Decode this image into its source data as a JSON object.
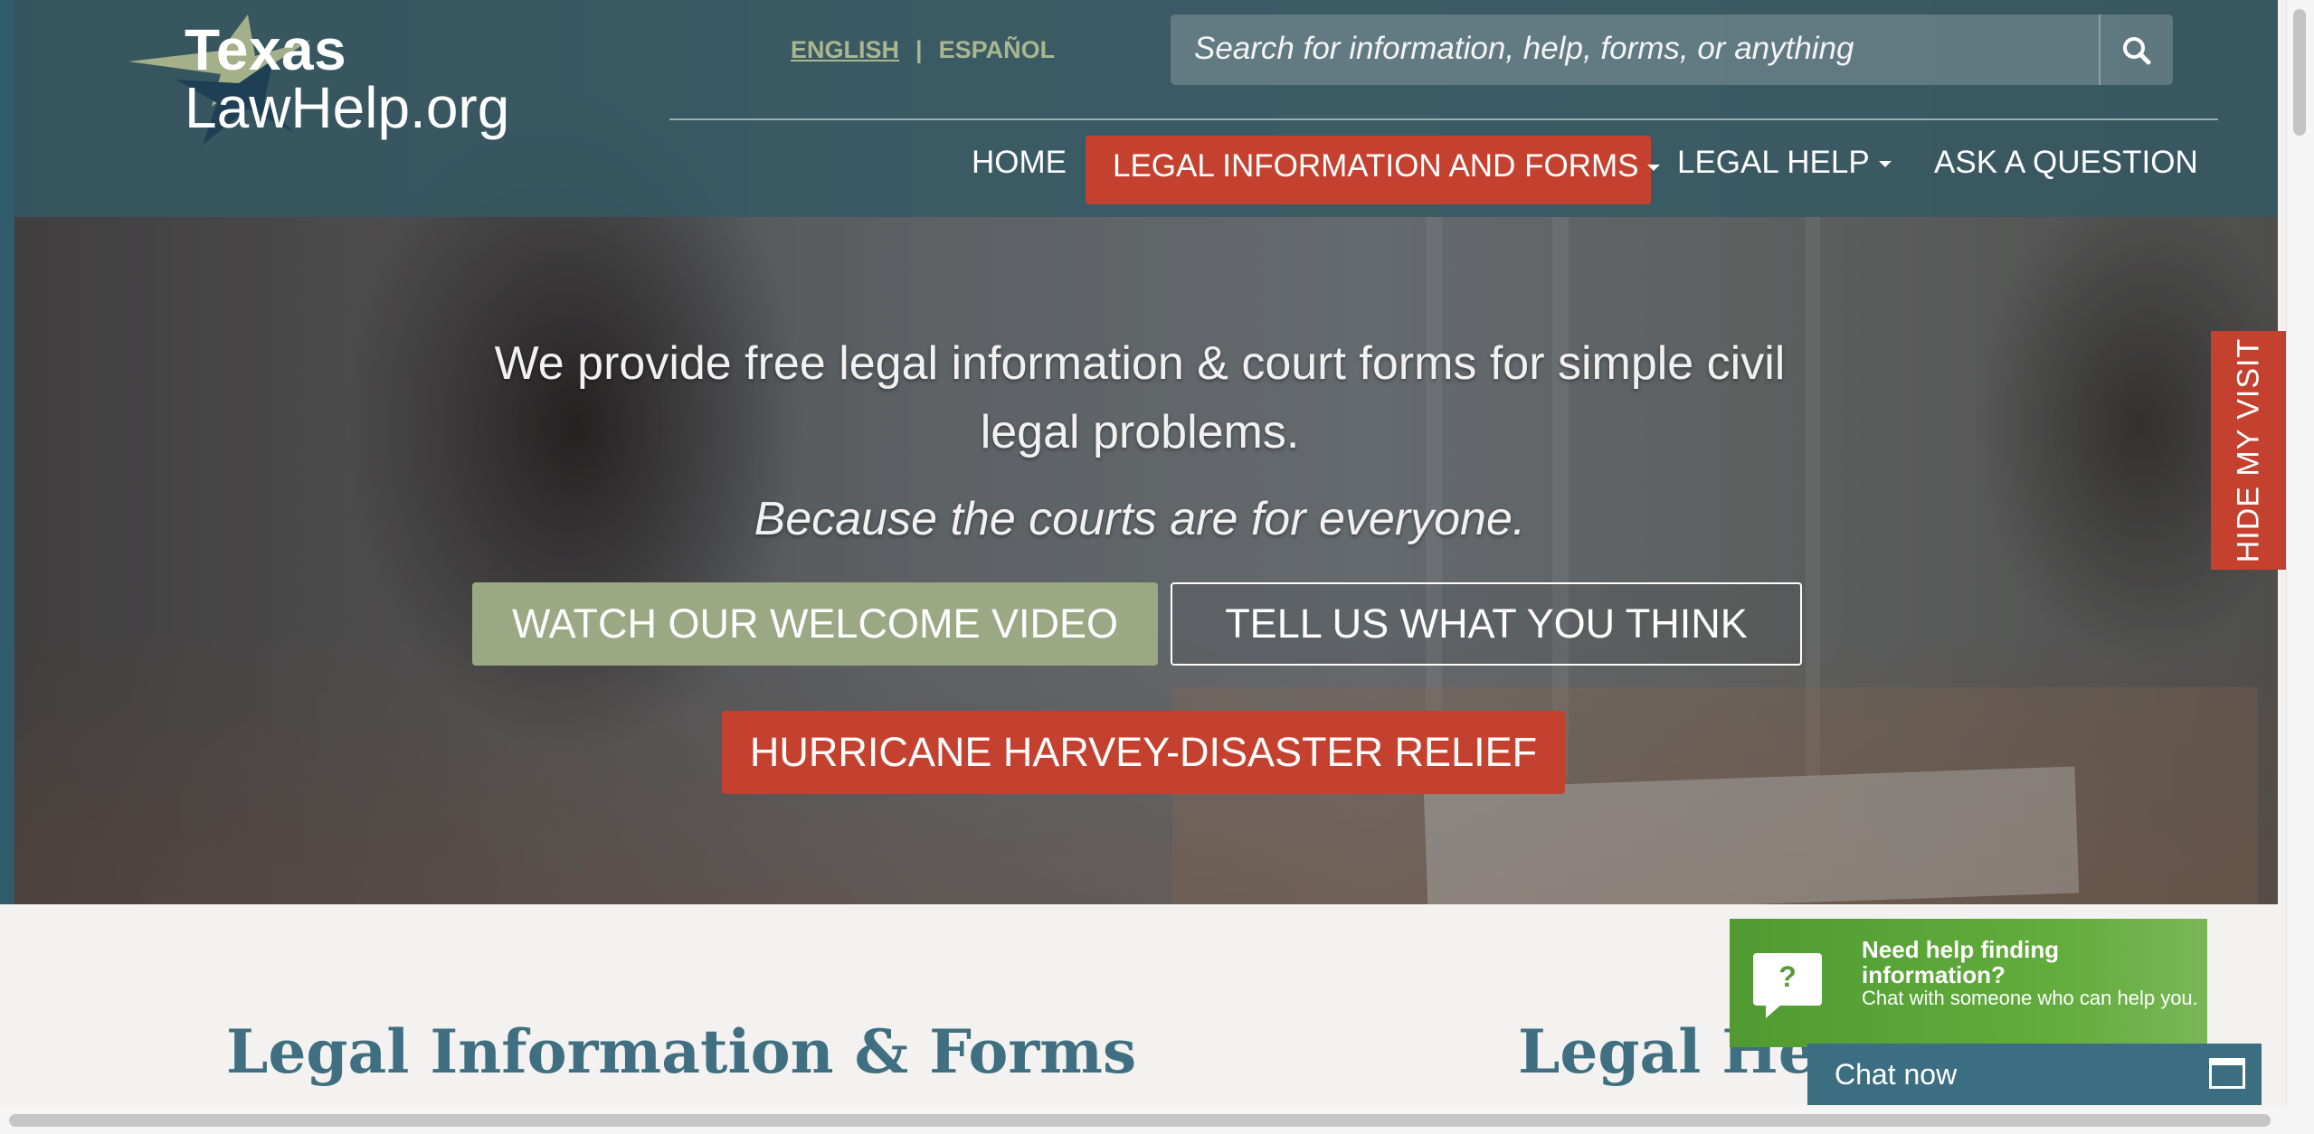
{
  "logo": {
    "line1": "Texas",
    "line2": "LawHelp.org"
  },
  "language": {
    "english": "ENGLISH",
    "separator": "|",
    "spanish": "ESPAÑOL"
  },
  "search": {
    "placeholder": "Search for information, help, forms, or anything",
    "icon": "search-icon"
  },
  "nav": {
    "home": "HOME",
    "legal_info": "LEGAL INFORMATION AND FORMS",
    "legal_help": "LEGAL HELP",
    "ask": "ASK A QUESTION"
  },
  "hero": {
    "tagline": "We provide free legal information & court forms for simple civil legal problems.",
    "subtag": "Because the courts are for everyone.",
    "btn_video": "WATCH OUR WELCOME VIDEO",
    "btn_think": "TELL US WHAT YOU THINK",
    "btn_harvey": "HURRICANE HARVEY-DISASTER RELIEF"
  },
  "hide_visit": "HIDE MY VISIT",
  "sections": {
    "legal_info_forms": "Legal Information & Forms",
    "legal_help": "Legal Help"
  },
  "chat": {
    "question_mark": "?",
    "heading": "Need help finding information?",
    "subtext": "Chat with someone who can help you.",
    "now": "Chat now"
  },
  "colors": {
    "header": "#345864",
    "accent_red": "#c5412f",
    "accent_green": "#9aa884",
    "heading_blue": "#3f6f80",
    "chat_green": "#5aa337",
    "chat_bar": "#3c6e82"
  }
}
